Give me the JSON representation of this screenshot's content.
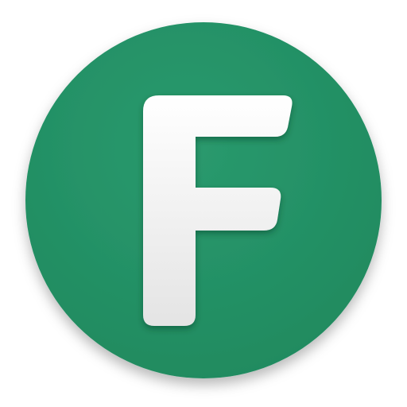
{
  "icon": {
    "name": "f-letter-app-icon",
    "letter": "F",
    "colors": {
      "circle": "#2a9a6e",
      "circle_dark": "#1f8a5f",
      "letter_light": "#ffffff",
      "letter_shade": "#e4e4e4"
    }
  }
}
